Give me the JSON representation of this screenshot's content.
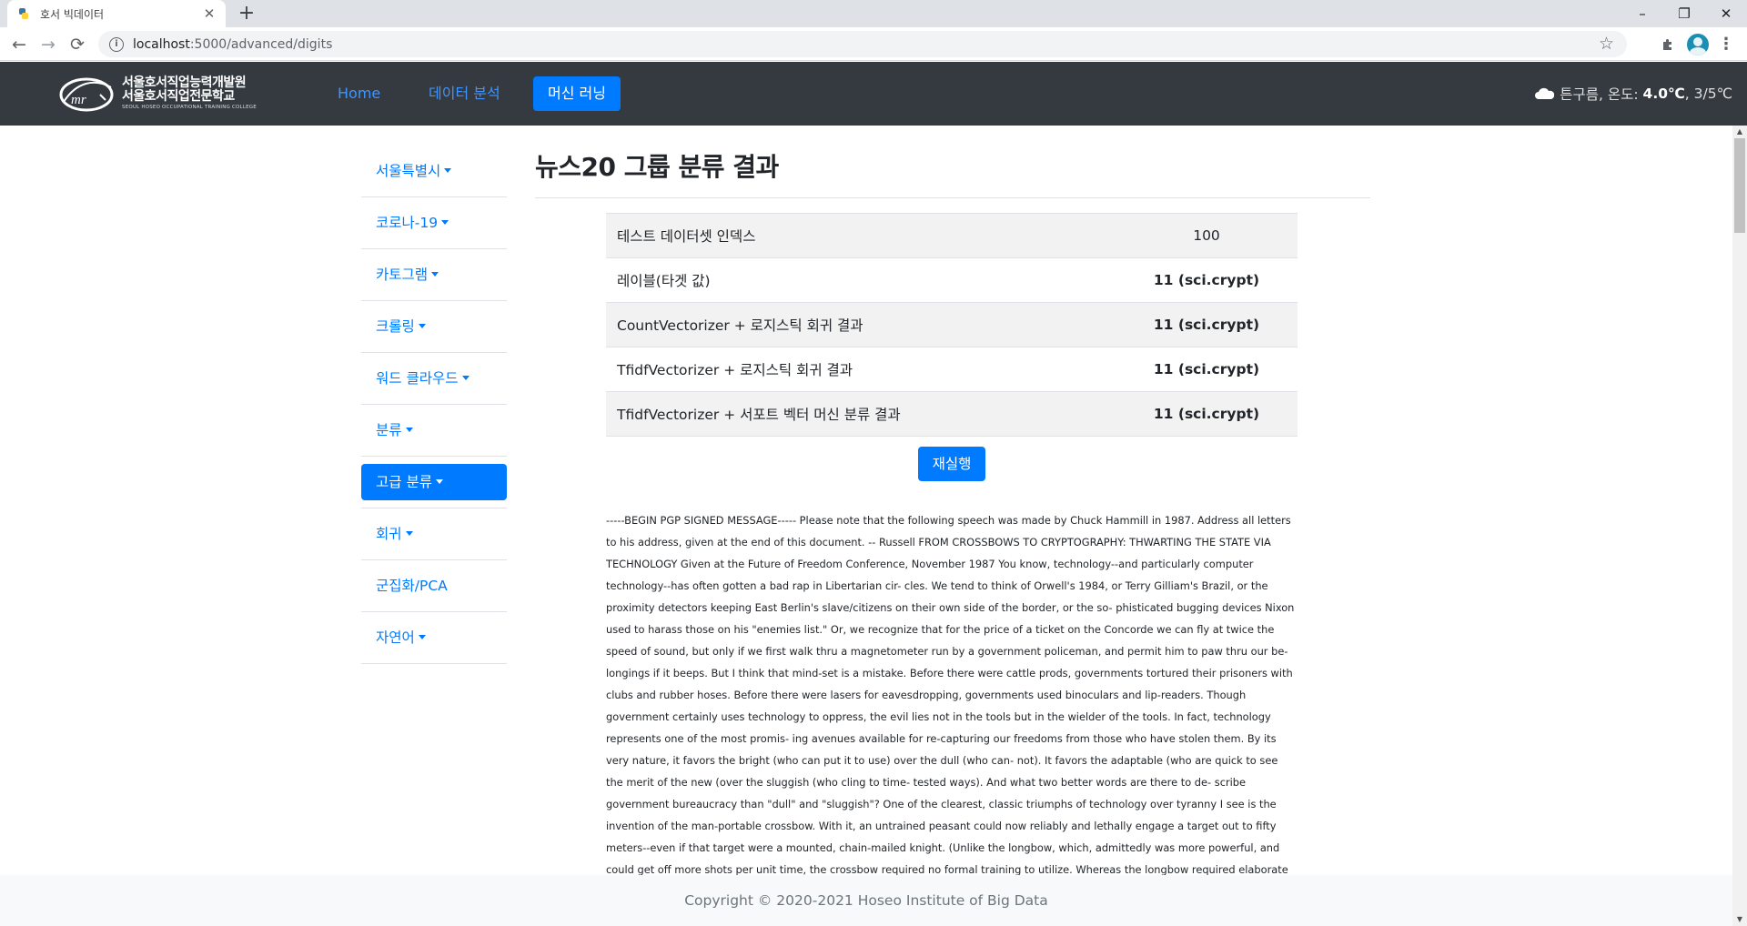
{
  "browser": {
    "tab_title": "호서 빅데이터",
    "new_tab": "+",
    "url_host": "localhost",
    "url_path": ":5000/advanced/digits",
    "window_controls": {
      "minimize": "–",
      "restore": "❐",
      "close": "✕"
    }
  },
  "navbar": {
    "brand_line1": "서울호서직업능력개발원",
    "brand_line2": "서울호서직업전문학교",
    "brand_sub": "SEOUL HOSEO OCCUPATIONAL TRAINING COLLEGE",
    "links": [
      {
        "label": "Home"
      },
      {
        "label": "데이터 분석"
      },
      {
        "label": "머신 러닝",
        "active": true
      }
    ],
    "weather": {
      "condition": "튼구름, 온도: ",
      "temp": "4.0℃",
      "range": ", 3/5℃",
      "icon": "cloud-icon"
    }
  },
  "sidebar": {
    "items": [
      {
        "label": "서울특별시"
      },
      {
        "label": "코로나-19"
      },
      {
        "label": "카토그램"
      },
      {
        "label": "크롤링"
      },
      {
        "label": "워드 클라우드"
      },
      {
        "label": "분류"
      },
      {
        "label": "고급 분류",
        "active": true
      },
      {
        "label": "회귀"
      },
      {
        "label": "군집화/PCA"
      },
      {
        "label": "자연어"
      }
    ]
  },
  "main": {
    "title": "뉴스20 그룹 분류 결과",
    "rows": [
      {
        "label": "테스트 데이터셋 인덱스",
        "value": "100"
      },
      {
        "label": "레이블(타겟 값)",
        "value": "11 (sci.crypt)"
      },
      {
        "label": "CountVectorizer + 로지스틱 회귀 결과",
        "value": "11 (sci.crypt)"
      },
      {
        "label": "TfidfVectorizer + 로지스틱 회귀 결과",
        "value": "11 (sci.crypt)"
      },
      {
        "label": "TfidfVectorizer + 서포트 벡터 머신 분류 결과",
        "value": "11 (sci.crypt)"
      }
    ],
    "rerun_label": "재실행",
    "news_text": "-----BEGIN PGP SIGNED MESSAGE----- Please note that the following speech was made by Chuck Hammill in 1987. Address all letters to his address, given at the end of this document. -- Russell FROM CROSSBOWS TO CRYPTOGRAPHY: THWARTING THE STATE VIA TECHNOLOGY Given at the Future of Freedom Conference, November 1987 You know, technology--and particularly computer technology--has often gotten a bad rap in Libertarian cir- cles. We tend to think of Orwell's 1984, or Terry Gilliam's Brazil, or the proximity detectors keeping East Berlin's slave/citizens on their own side of the border, or the so- phisticated bugging devices Nixon used to harass those on his \"enemies list.\" Or, we recognize that for the price of a ticket on the Concorde we can fly at twice the speed of sound, but only if we first walk thru a magnetometer run by a government policeman, and permit him to paw thru our be- longings if it beeps. But I think that mind-set is a mistake. Before there were cattle prods, governments tortured their prisoners with clubs and rubber hoses. Before there were lasers for eavesdropping, governments used binoculars and lip-readers. Though government certainly uses technology to oppress, the evil lies not in the tools but in the wielder of the tools. In fact, technology represents one of the most promis- ing avenues available for re-capturing our freedoms from those who have stolen them. By its very nature, it favors the bright (who can put it to use) over the dull (who can- not). It favors the adaptable (who are quick to see the merit of the new (over the sluggish (who cling to time- tested ways). And what two better words are there to de- scribe government bureaucracy than \"dull\" and \"sluggish\"? One of the clearest, classic triumphs of technology over tyranny I see is the invention of the man-portable crossbow. With it, an untrained peasant could now reliably and lethally engage a target out to fifty meters--even if that target were a mounted, chain-mailed knight. (Unlike the longbow, which, admittedly was more powerful, and could get off more shots per unit time, the crossbow required no formal training to utilize. Whereas the longbow required elaborate visual, tactile and kinesthetic coordination to achieve"
  },
  "footer": {
    "copyright": "Copyright © 2020-2021 Hoseo Institute of Big Data"
  },
  "colors": {
    "navbar_bg": "#343a40",
    "accent": "#007bff",
    "link": "#3f95ff"
  }
}
